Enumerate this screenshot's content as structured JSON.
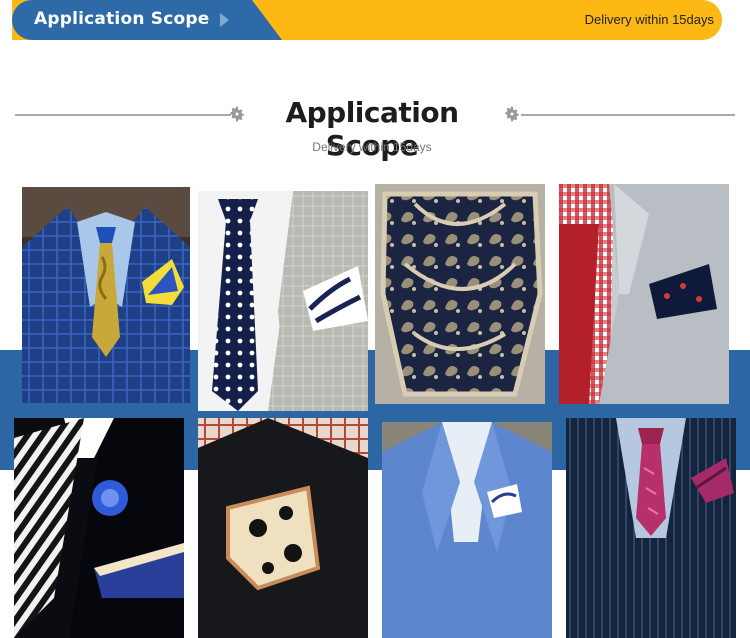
{
  "banner": {
    "title": "Application Scope",
    "right_text": "Delivery within 15days",
    "colors": {
      "blue": "#2f6aa8",
      "yellow": "#fdb813"
    }
  },
  "section": {
    "heading": "Application Scope",
    "subheading": "Delivery within 15days",
    "icons": [
      "gear-icon",
      "gear-icon"
    ]
  },
  "gallery": {
    "band_color": "#2d67a3",
    "photos": [
      {
        "id": "photo-navy-check-suit-paisley-tie"
      },
      {
        "id": "photo-grey-suit-polka-dot-tie"
      },
      {
        "id": "photo-paisley-pocket-square"
      },
      {
        "id": "photo-grey-jacket-red-gingham"
      },
      {
        "id": "photo-black-suit-striped-tie-rosette"
      },
      {
        "id": "photo-black-jacket-polka-pocket-square"
      },
      {
        "id": "photo-blue-blazer-white-pocket-square"
      },
      {
        "id": "photo-pinstripe-suit-magenta-tie"
      }
    ]
  }
}
